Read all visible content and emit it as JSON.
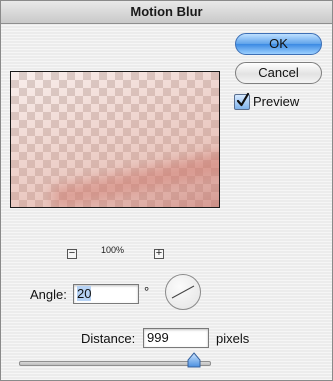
{
  "window": {
    "title": "Motion Blur"
  },
  "buttons": {
    "ok_label": "OK",
    "cancel_label": "Cancel"
  },
  "preview_toggle": {
    "label": "Preview",
    "checked": true
  },
  "zoom": {
    "minus_label": "−",
    "plus_label": "+",
    "level": "100%"
  },
  "angle": {
    "label": "Angle:",
    "value": "20",
    "unit": "°"
  },
  "distance": {
    "label": "Distance:",
    "value": "999",
    "unit": "pixels",
    "slider_fraction": 0.92
  },
  "colors": {
    "accent": "#3b8ae3",
    "preview_tint": "#d99a8c"
  }
}
